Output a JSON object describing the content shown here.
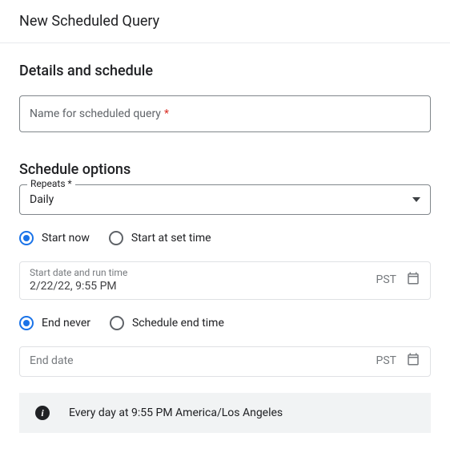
{
  "header": {
    "title": "New Scheduled Query"
  },
  "details": {
    "title": "Details and schedule",
    "name_placeholder": "Name for scheduled query",
    "required_mark": "*"
  },
  "schedule": {
    "title": "Schedule options",
    "repeats_label": "Repeats *",
    "repeats_value": "Daily",
    "start_options": {
      "now": "Start now",
      "set": "Start at set time",
      "selected": "now"
    },
    "start_date": {
      "label": "Start date and run time",
      "value": "2/22/22, 9:55 PM",
      "tz": "PST"
    },
    "end_options": {
      "never": "End never",
      "set": "Schedule end time",
      "selected": "never"
    },
    "end_date": {
      "placeholder": "End date",
      "tz": "PST"
    },
    "summary": "Every day at 9:55 PM America/Los Angeles"
  }
}
